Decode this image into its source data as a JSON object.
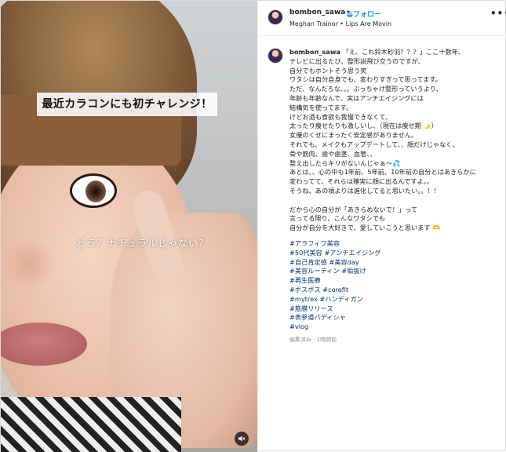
{
  "media": {
    "caption_box": "最近カラコンにも初チャレンジ！",
    "overlay_text": "どう？ナチュラルじゃない？",
    "mute_icon": "speaker-muted-icon"
  },
  "header": {
    "username": "bombon_sawa",
    "verified_icon": "check",
    "dot": "•",
    "follow_label": "フォロー",
    "music": "Meghan Trainor • Lips Are Movin",
    "more_icon": "•••"
  },
  "caption": {
    "username": "bombon_sawa",
    "lines": [
      "「え、これ鈴木砂羽？？？」ここ十数年、",
      "テレビに出るたび、整形説飛び交うのですが、",
      "自分でもホントそう思う笑",
      "ワタシは自分自身でも、変わりすぎって思ってます。",
      "ただ、なんだろな、。。ぶっちゃけ整形っていうより、",
      "年齢も年齢なんで、実はアンチエイジングには",
      "結構気を使ってます。",
      "けどお酒も食欲も我慢できなくて、",
      "太ったり痩せたりも激しいし、（現在は痩せ期 🌛）",
      "女優のくせにまったく安定感がありません。",
      "それでも、メイクもアップデートして、、顔だけじゃなく、",
      "骨や筋肉、歯や歯茎、血管、、",
      "整え出したらキリがないんじゃぁ〜💦",
      "あとは、、心の中も1年前、5年前、10年前の自分とはあきらかに",
      "変わってて、それらは確実に顔に出るんですよ。。",
      "そうね、あの頃よりは進化してると思いたい。。！！",
      "",
      "だから心の自分が「あきらめないで！」って",
      "言ってる限り、こんなワタシでも",
      "自分が自分を大好きで、愛していこうと思います 🫶"
    ]
  },
  "hashtags": [
    "#アラフィフ美容",
    "#50代美容 #アンチエイジング",
    "#自己肯定感 #美容day",
    "#美容ルーティン #垢抜け",
    "#再生医療",
    "#ボスボス #corefit",
    "#mytrex #ハンディガン",
    "#筋膜リリース",
    "#表参道バディシャ",
    "#vlog"
  ],
  "meta": "編集済み · 1時間前"
}
